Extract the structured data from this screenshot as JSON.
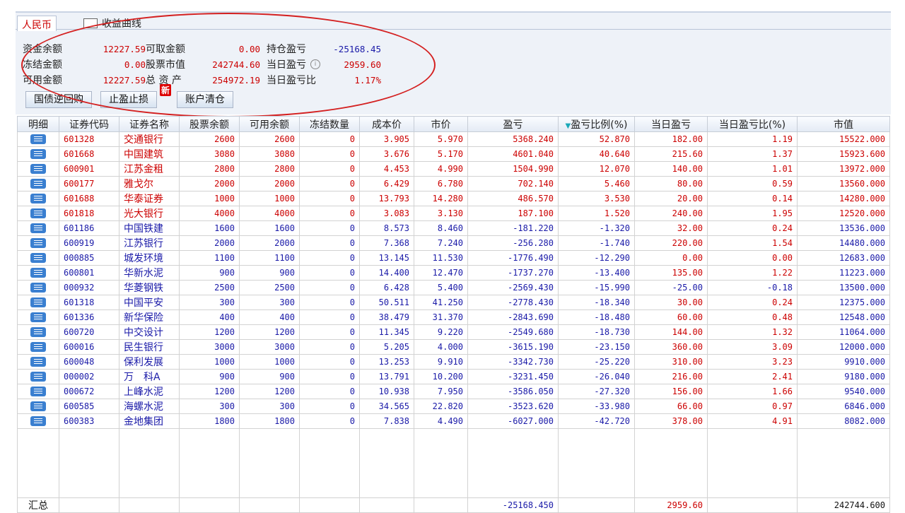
{
  "tabs": {
    "rmb": "人民币",
    "curve": "收益曲线"
  },
  "summary": {
    "cash_balance_label": "资金余额",
    "cash_balance": "12227.59",
    "frozen_label": "冻结金额",
    "frozen": "0.00",
    "available_label": "可用金额",
    "available": "12227.59",
    "withdrawable_label": "可取金额",
    "withdrawable": "0.00",
    "stock_value_label": "股票市值",
    "stock_value": "242744.60",
    "total_assets_label": "总 资 产",
    "total_assets": "254972.19",
    "position_pnl_label": "持仓盈亏",
    "position_pnl": "-25168.45",
    "day_pnl_label": "当日盈亏",
    "day_pnl": "2959.60",
    "day_pnl_ratio_label": "当日盈亏比",
    "day_pnl_ratio": "1.17%"
  },
  "buttons": {
    "repo": "国债逆回购",
    "stop": "止盈止损",
    "new_badge": "新",
    "clear": "账户清仓"
  },
  "columns": [
    "明细",
    "证券代码",
    "证券名称",
    "股票余额",
    "可用余额",
    "冻结数量",
    "成本价",
    "市价",
    "盈亏",
    "盈亏比例(%)",
    "当日盈亏",
    "当日盈亏比(%)",
    "市值"
  ],
  "sort_indicator": "▼",
  "colors": {
    "positive": "#cc0000",
    "negative": "#1a1aa8"
  },
  "rows": [
    [
      "601328",
      "交通银行",
      "2600",
      "2600",
      "0",
      "3.905",
      "5.970",
      "5368.240",
      "52.870",
      "182.00",
      "1.19",
      "15522.000"
    ],
    [
      "601668",
      "中国建筑",
      "3080",
      "3080",
      "0",
      "3.676",
      "5.170",
      "4601.040",
      "40.640",
      "215.60",
      "1.37",
      "15923.600"
    ],
    [
      "600901",
      "江苏金租",
      "2800",
      "2800",
      "0",
      "4.453",
      "4.990",
      "1504.990",
      "12.070",
      "140.00",
      "1.01",
      "13972.000"
    ],
    [
      "600177",
      "雅戈尔",
      "2000",
      "2000",
      "0",
      "6.429",
      "6.780",
      "702.140",
      "5.460",
      "80.00",
      "0.59",
      "13560.000"
    ],
    [
      "601688",
      "华泰证券",
      "1000",
      "1000",
      "0",
      "13.793",
      "14.280",
      "486.570",
      "3.530",
      "20.00",
      "0.14",
      "14280.000"
    ],
    [
      "601818",
      "光大银行",
      "4000",
      "4000",
      "0",
      "3.083",
      "3.130",
      "187.100",
      "1.520",
      "240.00",
      "1.95",
      "12520.000"
    ],
    [
      "601186",
      "中国铁建",
      "1600",
      "1600",
      "0",
      "8.573",
      "8.460",
      "-181.220",
      "-1.320",
      "32.00",
      "0.24",
      "13536.000"
    ],
    [
      "600919",
      "江苏银行",
      "2000",
      "2000",
      "0",
      "7.368",
      "7.240",
      "-256.280",
      "-1.740",
      "220.00",
      "1.54",
      "14480.000"
    ],
    [
      "000885",
      "城发环境",
      "1100",
      "1100",
      "0",
      "13.145",
      "11.530",
      "-1776.490",
      "-12.290",
      "0.00",
      "0.00",
      "12683.000"
    ],
    [
      "600801",
      "华新水泥",
      "900",
      "900",
      "0",
      "14.400",
      "12.470",
      "-1737.270",
      "-13.400",
      "135.00",
      "1.22",
      "11223.000"
    ],
    [
      "000932",
      "华菱钢铁",
      "2500",
      "2500",
      "0",
      "6.428",
      "5.400",
      "-2569.430",
      "-15.990",
      "-25.00",
      "-0.18",
      "13500.000"
    ],
    [
      "601318",
      "中国平安",
      "300",
      "300",
      "0",
      "50.511",
      "41.250",
      "-2778.430",
      "-18.340",
      "30.00",
      "0.24",
      "12375.000"
    ],
    [
      "601336",
      "新华保险",
      "400",
      "400",
      "0",
      "38.479",
      "31.370",
      "-2843.690",
      "-18.480",
      "60.00",
      "0.48",
      "12548.000"
    ],
    [
      "600720",
      "中交设计",
      "1200",
      "1200",
      "0",
      "11.345",
      "9.220",
      "-2549.680",
      "-18.730",
      "144.00",
      "1.32",
      "11064.000"
    ],
    [
      "600016",
      "民生银行",
      "3000",
      "3000",
      "0",
      "5.205",
      "4.000",
      "-3615.190",
      "-23.150",
      "360.00",
      "3.09",
      "12000.000"
    ],
    [
      "600048",
      "保利发展",
      "1000",
      "1000",
      "0",
      "13.253",
      "9.910",
      "-3342.730",
      "-25.220",
      "310.00",
      "3.23",
      "9910.000"
    ],
    [
      "000002",
      "万　科A",
      "900",
      "900",
      "0",
      "13.791",
      "10.200",
      "-3231.450",
      "-26.040",
      "216.00",
      "2.41",
      "9180.000"
    ],
    [
      "000672",
      "上峰水泥",
      "1200",
      "1200",
      "0",
      "10.938",
      "7.950",
      "-3586.050",
      "-27.320",
      "156.00",
      "1.66",
      "9540.000"
    ],
    [
      "600585",
      "海螺水泥",
      "300",
      "300",
      "0",
      "34.565",
      "22.820",
      "-3523.620",
      "-33.980",
      "66.00",
      "0.97",
      "6846.000"
    ],
    [
      "600383",
      "金地集团",
      "1800",
      "1800",
      "0",
      "7.838",
      "4.490",
      "-6027.000",
      "-42.720",
      "378.00",
      "4.91",
      "8082.000"
    ]
  ],
  "totals": {
    "label": "汇总",
    "pnl": "-25168.450",
    "day_pnl": "2959.60",
    "market_value": "242744.600"
  }
}
